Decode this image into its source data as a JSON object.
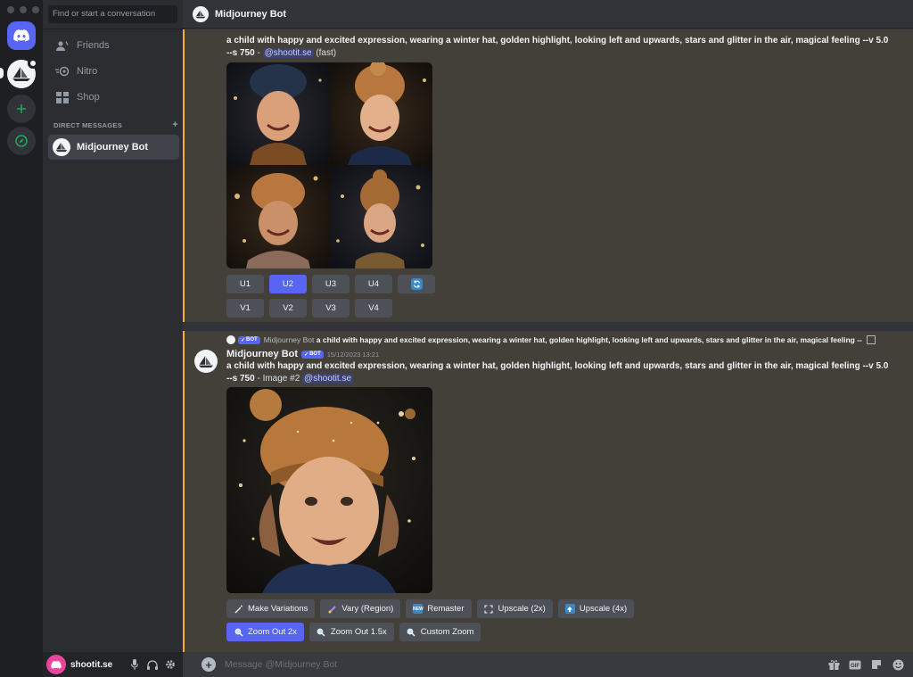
{
  "window": {
    "title": "Midjourney Bot"
  },
  "search": {
    "placeholder": "Find or start a conversation"
  },
  "nav": [
    {
      "label": "Friends",
      "icon": "friends-icon"
    },
    {
      "label": "Nitro",
      "icon": "nitro-icon"
    },
    {
      "label": "Shop",
      "icon": "shop-icon"
    }
  ],
  "direct_messages": {
    "header": "DIRECT MESSAGES",
    "add": "+",
    "items": [
      {
        "label": "Midjourney Bot"
      }
    ]
  },
  "user": {
    "name": "shootit.se"
  },
  "message1": {
    "prompt": "a child with happy and excited expression, wearing a winter hat, golden highlight, looking left and upwards, stars and glitter in the air, magical feeling --v 5.0 --s 750",
    "sep": " - ",
    "mention": "@shootit.se",
    "suffix": " (fast)",
    "row1": [
      "U1",
      "U2",
      "U3",
      "U4"
    ],
    "row2": [
      "V1",
      "V2",
      "V3",
      "V4"
    ],
    "active": "U2"
  },
  "message2": {
    "reply_author": "Midjourney Bot",
    "reply_text": "a child with happy and excited expression, wearing a winter hat, golden highlight, looking left and upwards, stars and glitter in the air, magical feeling --",
    "author": "Midjourney Bot",
    "bot_badge": "BOT",
    "timestamp": "15/12/2023 13:21",
    "prompt": "a child with happy and excited expression, wearing a winter hat, golden highlight, looking left and upwards, stars and glitter in the air, magical feeling --v 5.0 --s 750",
    "sep": " - Image #2 ",
    "mention": "@shootit.se",
    "buttons_row1": [
      "Make Variations",
      "Vary (Region)",
      "Remaster",
      "Upscale (2x)",
      "Upscale (4x)"
    ],
    "buttons_row2": [
      "Zoom Out 2x",
      "Zoom Out 1.5x",
      "Custom Zoom"
    ],
    "active": "Zoom Out 2x"
  },
  "composer": {
    "placeholder": "Message @Midjourney Bot"
  },
  "colors": {
    "accent": "#5865f2",
    "highlight_bar": "#f0b232",
    "green": "#23a55a"
  }
}
